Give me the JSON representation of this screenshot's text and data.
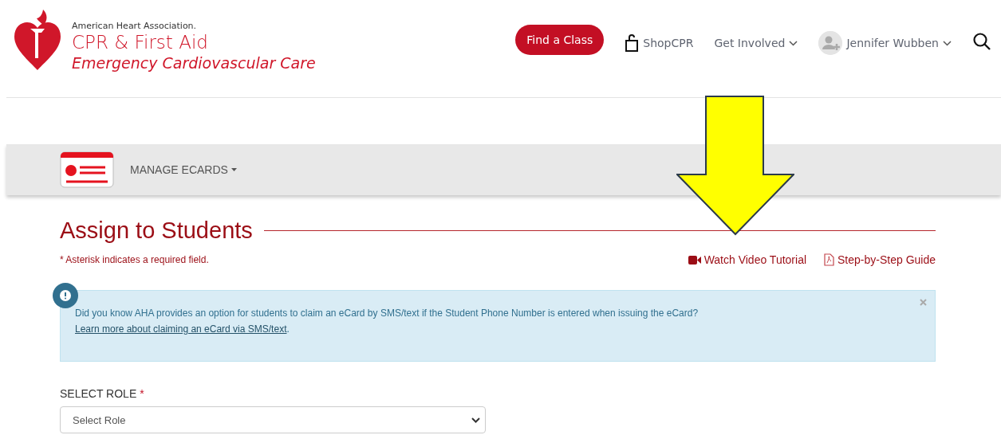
{
  "header": {
    "logo": {
      "org": "American Heart Association.",
      "title": "CPR & First Aid",
      "subtitle": "Emergency Cardiovascular Care"
    },
    "nav": [
      {
        "kind": "button",
        "label": "Find a Class"
      },
      {
        "kind": "shop",
        "label": "ShopCPR"
      },
      {
        "kind": "dropdown",
        "label": "Get Involved"
      },
      {
        "kind": "user",
        "label": "Jennifer Wubben"
      },
      {
        "kind": "search"
      }
    ]
  },
  "subnav": {
    "menu": "MANAGE ECARDS"
  },
  "page": {
    "title": "Assign to Students",
    "required_note": "* Asterisk indicates a required field.",
    "links": [
      {
        "kind": "video",
        "label": "Watch Video Tutorial"
      },
      {
        "kind": "pdf",
        "label": "Step-by-Step Guide"
      }
    ],
    "alert": {
      "text": "Did you know AHA provides an option for students to claim an eCard by SMS/text if the Student Phone Number is entered when issuing the eCard?",
      "link": "Learn more about claiming an eCard via SMS/text",
      "after_link": "."
    },
    "field": {
      "label": "SELECT ROLE",
      "required_mark": "*",
      "value": "Select Role"
    }
  },
  "annotation": {
    "kind": "arrow"
  }
}
